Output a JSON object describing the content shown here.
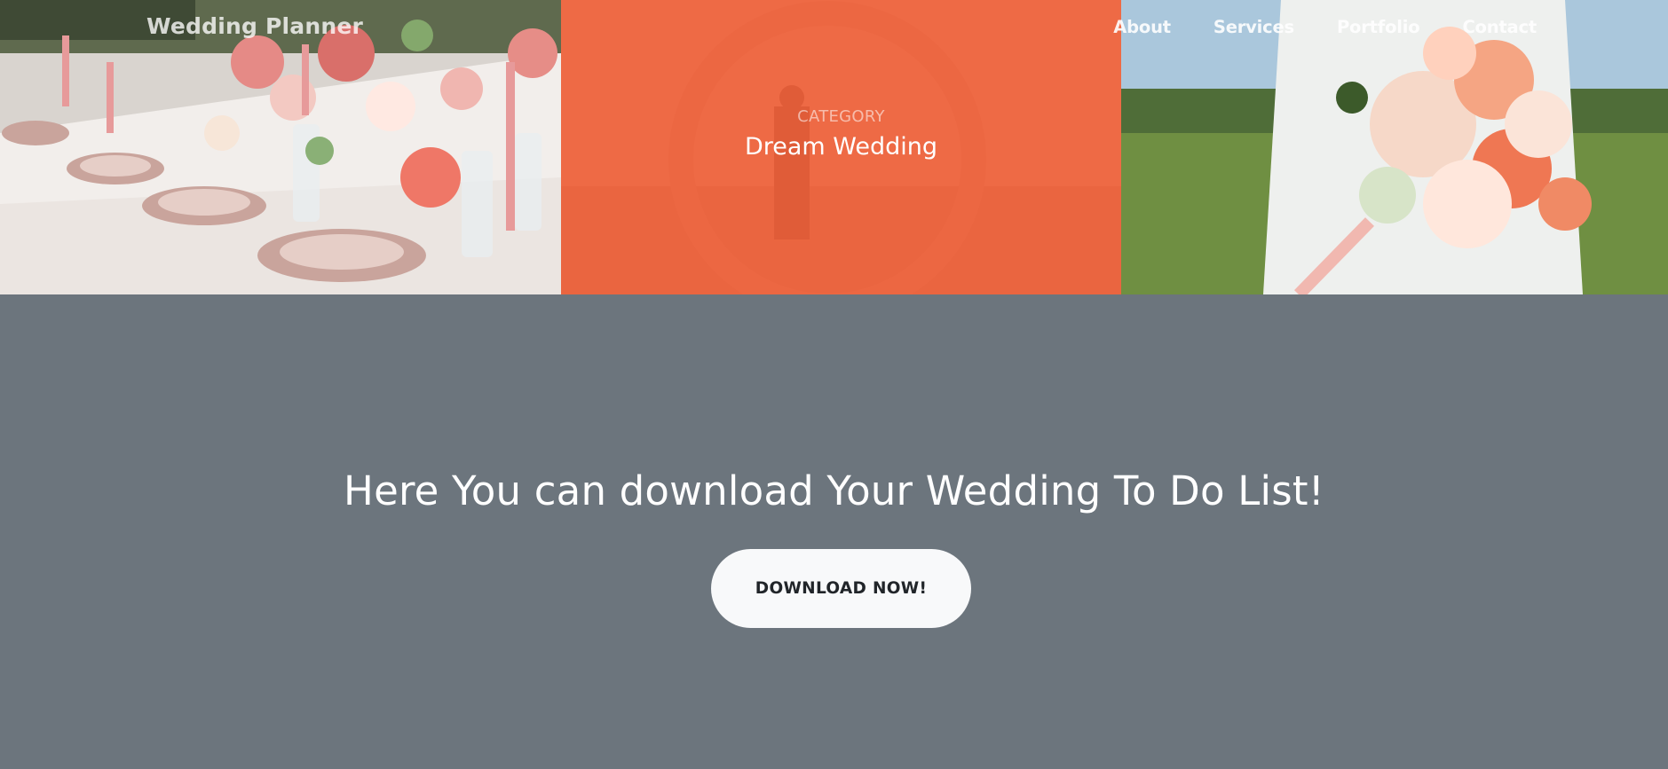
{
  "navbar": {
    "brand": "Wedding Planner",
    "links": [
      "About",
      "Services",
      "Portfolio",
      "Contact"
    ]
  },
  "portfolio": {
    "items": [
      {
        "image": "wedding-table-setting-image"
      },
      {
        "image": "floral-arch-couple-image",
        "category": "Category",
        "name": "Dream Wedding"
      },
      {
        "image": "bridal-bouquet-image"
      }
    ],
    "accent_color": "#f4623a"
  },
  "cta": {
    "title": "Here You can download Your Wedding To Do List!",
    "button_label": "DOWNLOAD NOW!"
  },
  "colors": {
    "section_bg": "#6c757d",
    "button_bg": "#f8f9fa",
    "button_text": "#212529"
  }
}
